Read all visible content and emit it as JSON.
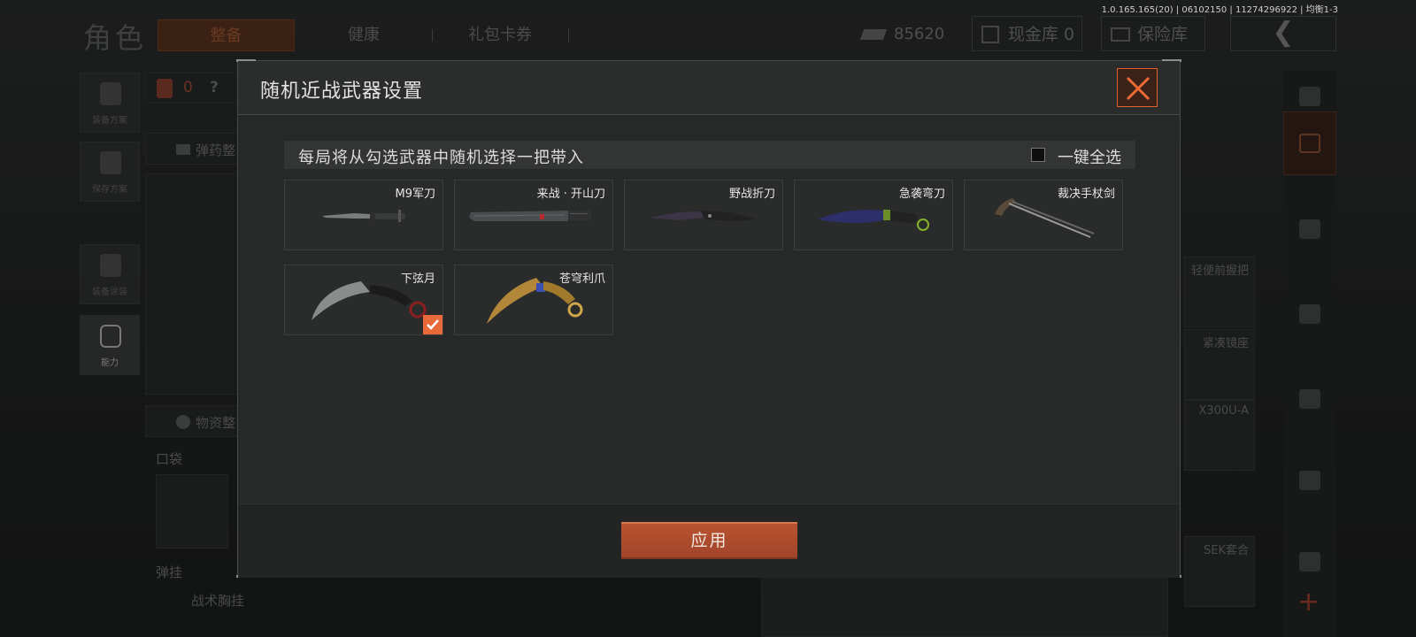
{
  "version_text": "1.0.165.165(20) | 06102150 | 11274296922 | 均衡1-3",
  "background": {
    "title": "角色",
    "tabs": [
      "整备",
      "健康",
      "礼包卡券"
    ],
    "money": "85620",
    "cash_storage": "现金库 0",
    "safe": "保险库",
    "left_buttons": [
      "装备方案",
      "保存方案",
      "装备涂装",
      "能力"
    ],
    "count_badge": "0",
    "count_help": "?",
    "section_ammo": "弹药整",
    "section_supplies": "物资整",
    "pocket": "口袋",
    "rig": "弹挂",
    "rig_item": "战术胸挂",
    "slots": [
      "轻便前握把",
      "紧凑镜座",
      "X300U-A",
      "SEK套合"
    ]
  },
  "modal": {
    "title": "随机近战武器设置",
    "info": "每局将从勾选武器中随机选择一把带入",
    "select_all": "一键全选",
    "weapons": [
      {
        "name": "M9军刀",
        "checked": false
      },
      {
        "name": "来战 · 开山刀",
        "checked": false
      },
      {
        "name": "野战折刀",
        "checked": false
      },
      {
        "name": "急袭弯刀",
        "checked": false
      },
      {
        "name": "裁决手杖剑",
        "checked": false
      },
      {
        "name": "下弦月",
        "checked": true
      },
      {
        "name": "苍穹利爪",
        "checked": false
      }
    ],
    "apply": "应用"
  },
  "colors": {
    "accent": "#e2602f",
    "apply_button": "#b04e2e",
    "check": "#e86a3a"
  }
}
